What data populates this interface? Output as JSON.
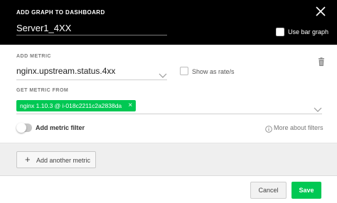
{
  "header": {
    "title": "ADD GRAPH TO DASHBOARD",
    "graph_name": "Server1_4XX",
    "bar_graph_label": "Use bar graph",
    "bar_graph_checked": false,
    "close_icon": "close-icon"
  },
  "metric": {
    "section_label": "ADD METRIC",
    "selected": "nginx.upstream.status.4xx",
    "rate_label": "Show as rate/s",
    "rate_checked": false,
    "delete_icon": "trash-icon"
  },
  "source": {
    "section_label": "GET METRIC FROM",
    "chip_label": "nginx 1.10.3 @ i-018c2211c2a2838da",
    "chip_remove": "×"
  },
  "filter": {
    "toggle_on": false,
    "label": "Add metric filter",
    "more_link": "More about filters"
  },
  "actions": {
    "add_another": "Add another metric",
    "add_icon": "+",
    "cancel": "Cancel",
    "save": "Save"
  },
  "colors": {
    "header_bg": "#000000",
    "accent_green": "#00c853",
    "grey_area": "#efefef"
  }
}
